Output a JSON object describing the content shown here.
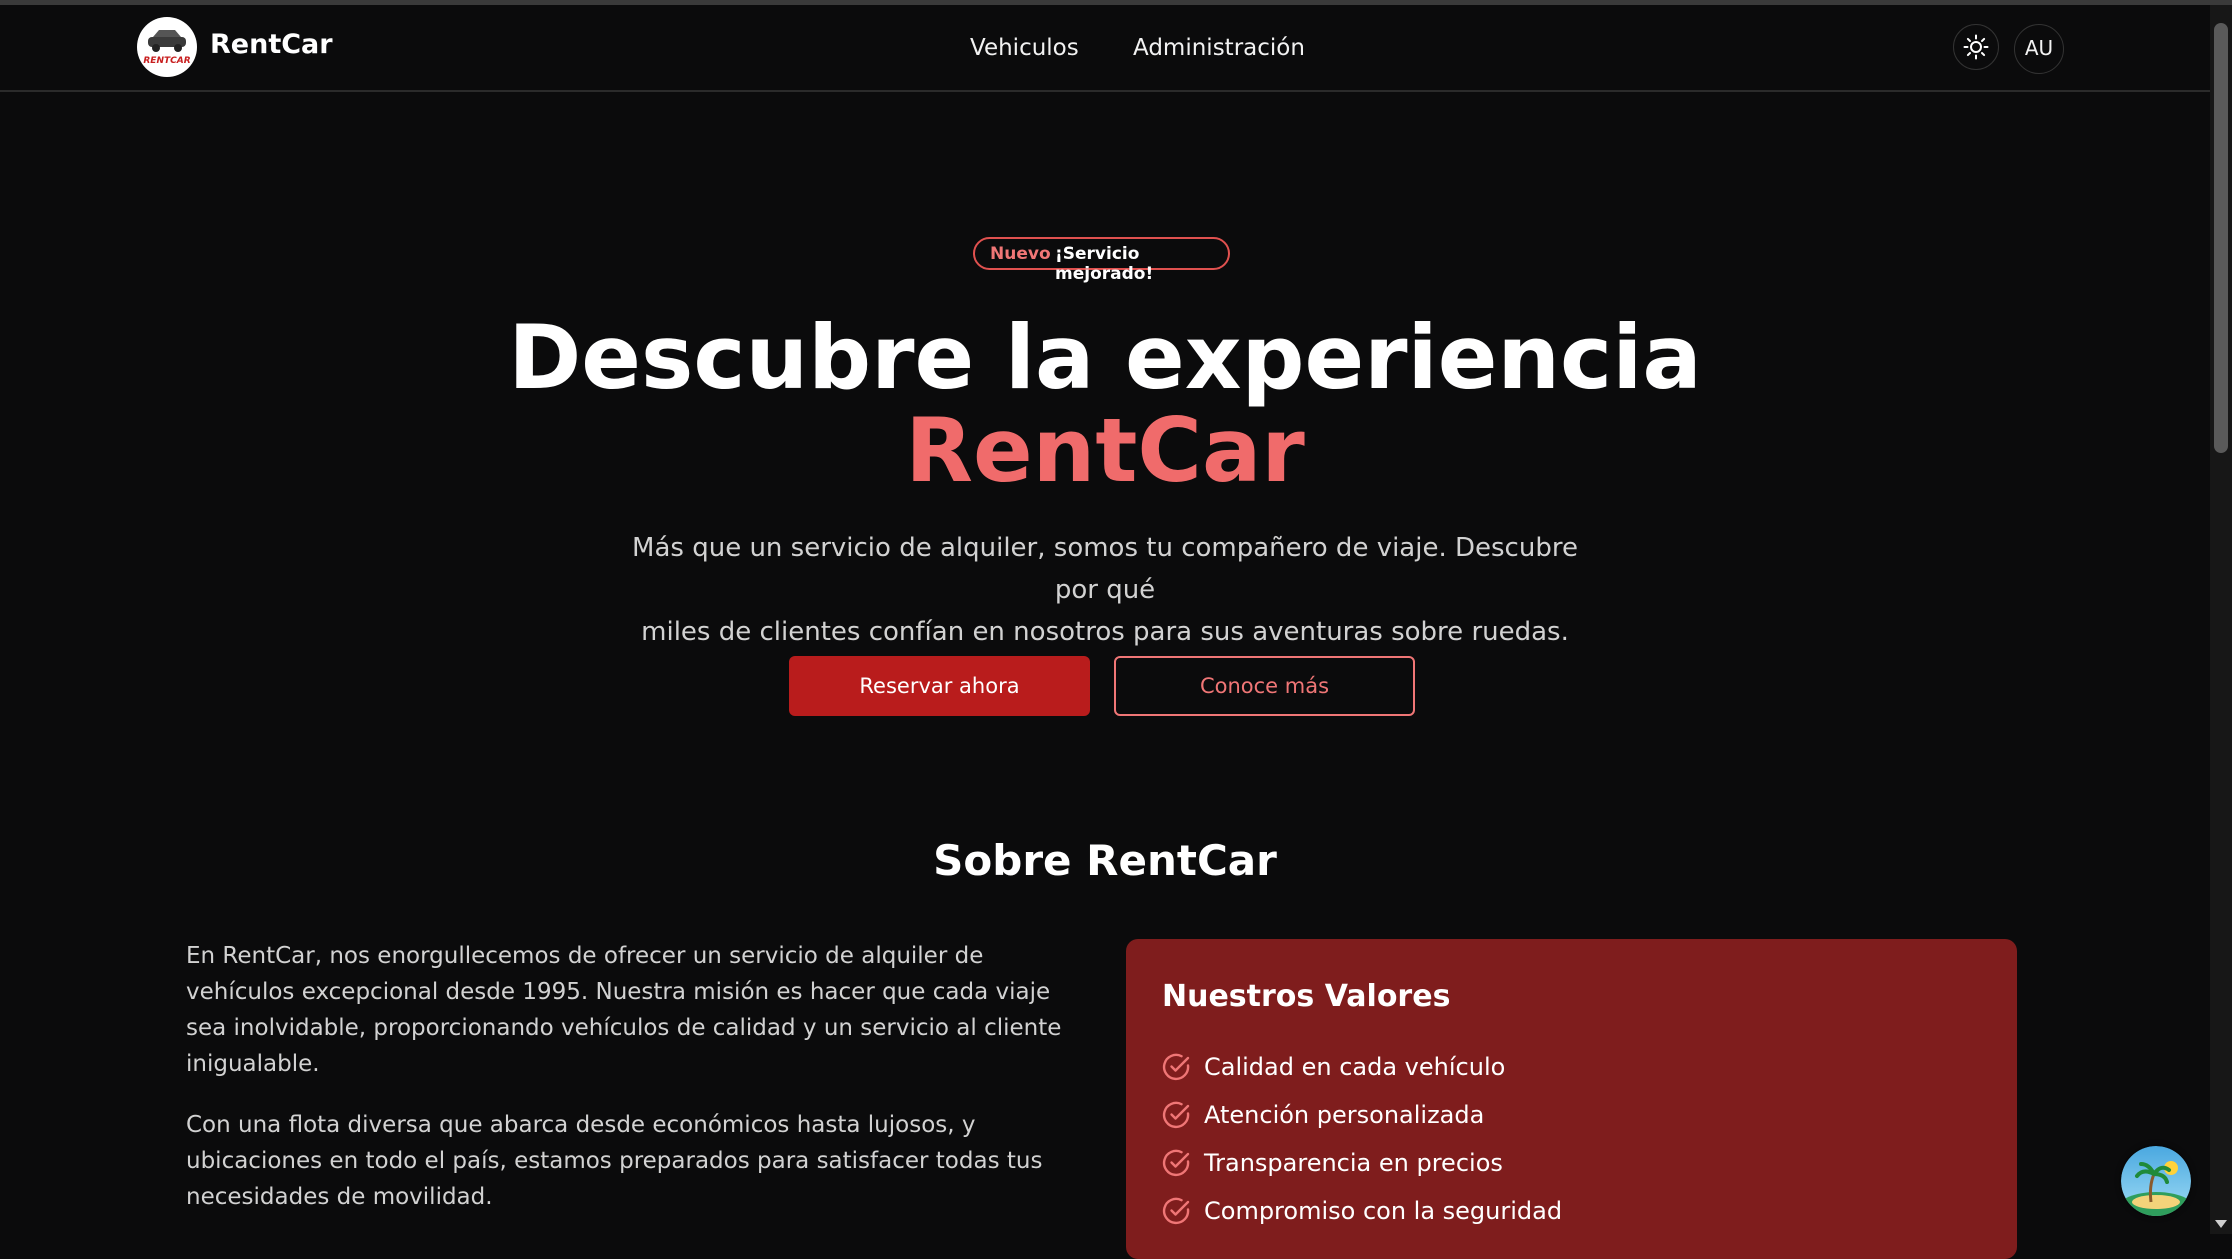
{
  "header": {
    "brand": "RentCar",
    "logo_text": "RENTCAR",
    "nav": [
      {
        "label": "Vehiculos"
      },
      {
        "label": "Administración"
      }
    ],
    "theme_icon": "sun-icon",
    "avatar_initials": "AU"
  },
  "hero": {
    "badge_tag": "Nuevo",
    "badge_text": "¡Servicio mejorado!",
    "title_line1": "Descubre la experiencia",
    "title_line2": "RentCar",
    "lead_line1": "Más que un servicio de alquiler, somos tu compañero de viaje. Descubre por qué",
    "lead_line2": "miles de clientes confían en nosotros para sus aventuras sobre ruedas.",
    "primary_button": "Reservar ahora",
    "secondary_button": "Conoce más"
  },
  "about": {
    "title": "Sobre RentCar",
    "paragraphs": [
      "En RentCar, nos enorgullecemos de ofrecer un servicio de alquiler de vehículos excepcional desde 1995. Nuestra misión es hacer que cada viaje sea inolvidable, proporcionando vehículos de calidad y un servicio al cliente inigualable.",
      "Con una flota diversa que abarca desde económicos hasta lujosos, y ubicaciones en todo el país, estamos preparados para satisfacer todas tus necesidades de movilidad."
    ],
    "values_title": "Nuestros Valores",
    "values": [
      "Calidad en cada vehículo",
      "Atención personalizada",
      "Transparencia en precios",
      "Compromiso con la seguridad"
    ]
  },
  "colors": {
    "background": "#0b0b0c",
    "accent": "#f06b6b",
    "primary_button": "#b91c1c",
    "values_card": "#7f1d1d"
  },
  "floating_widget_icon": "island-icon"
}
